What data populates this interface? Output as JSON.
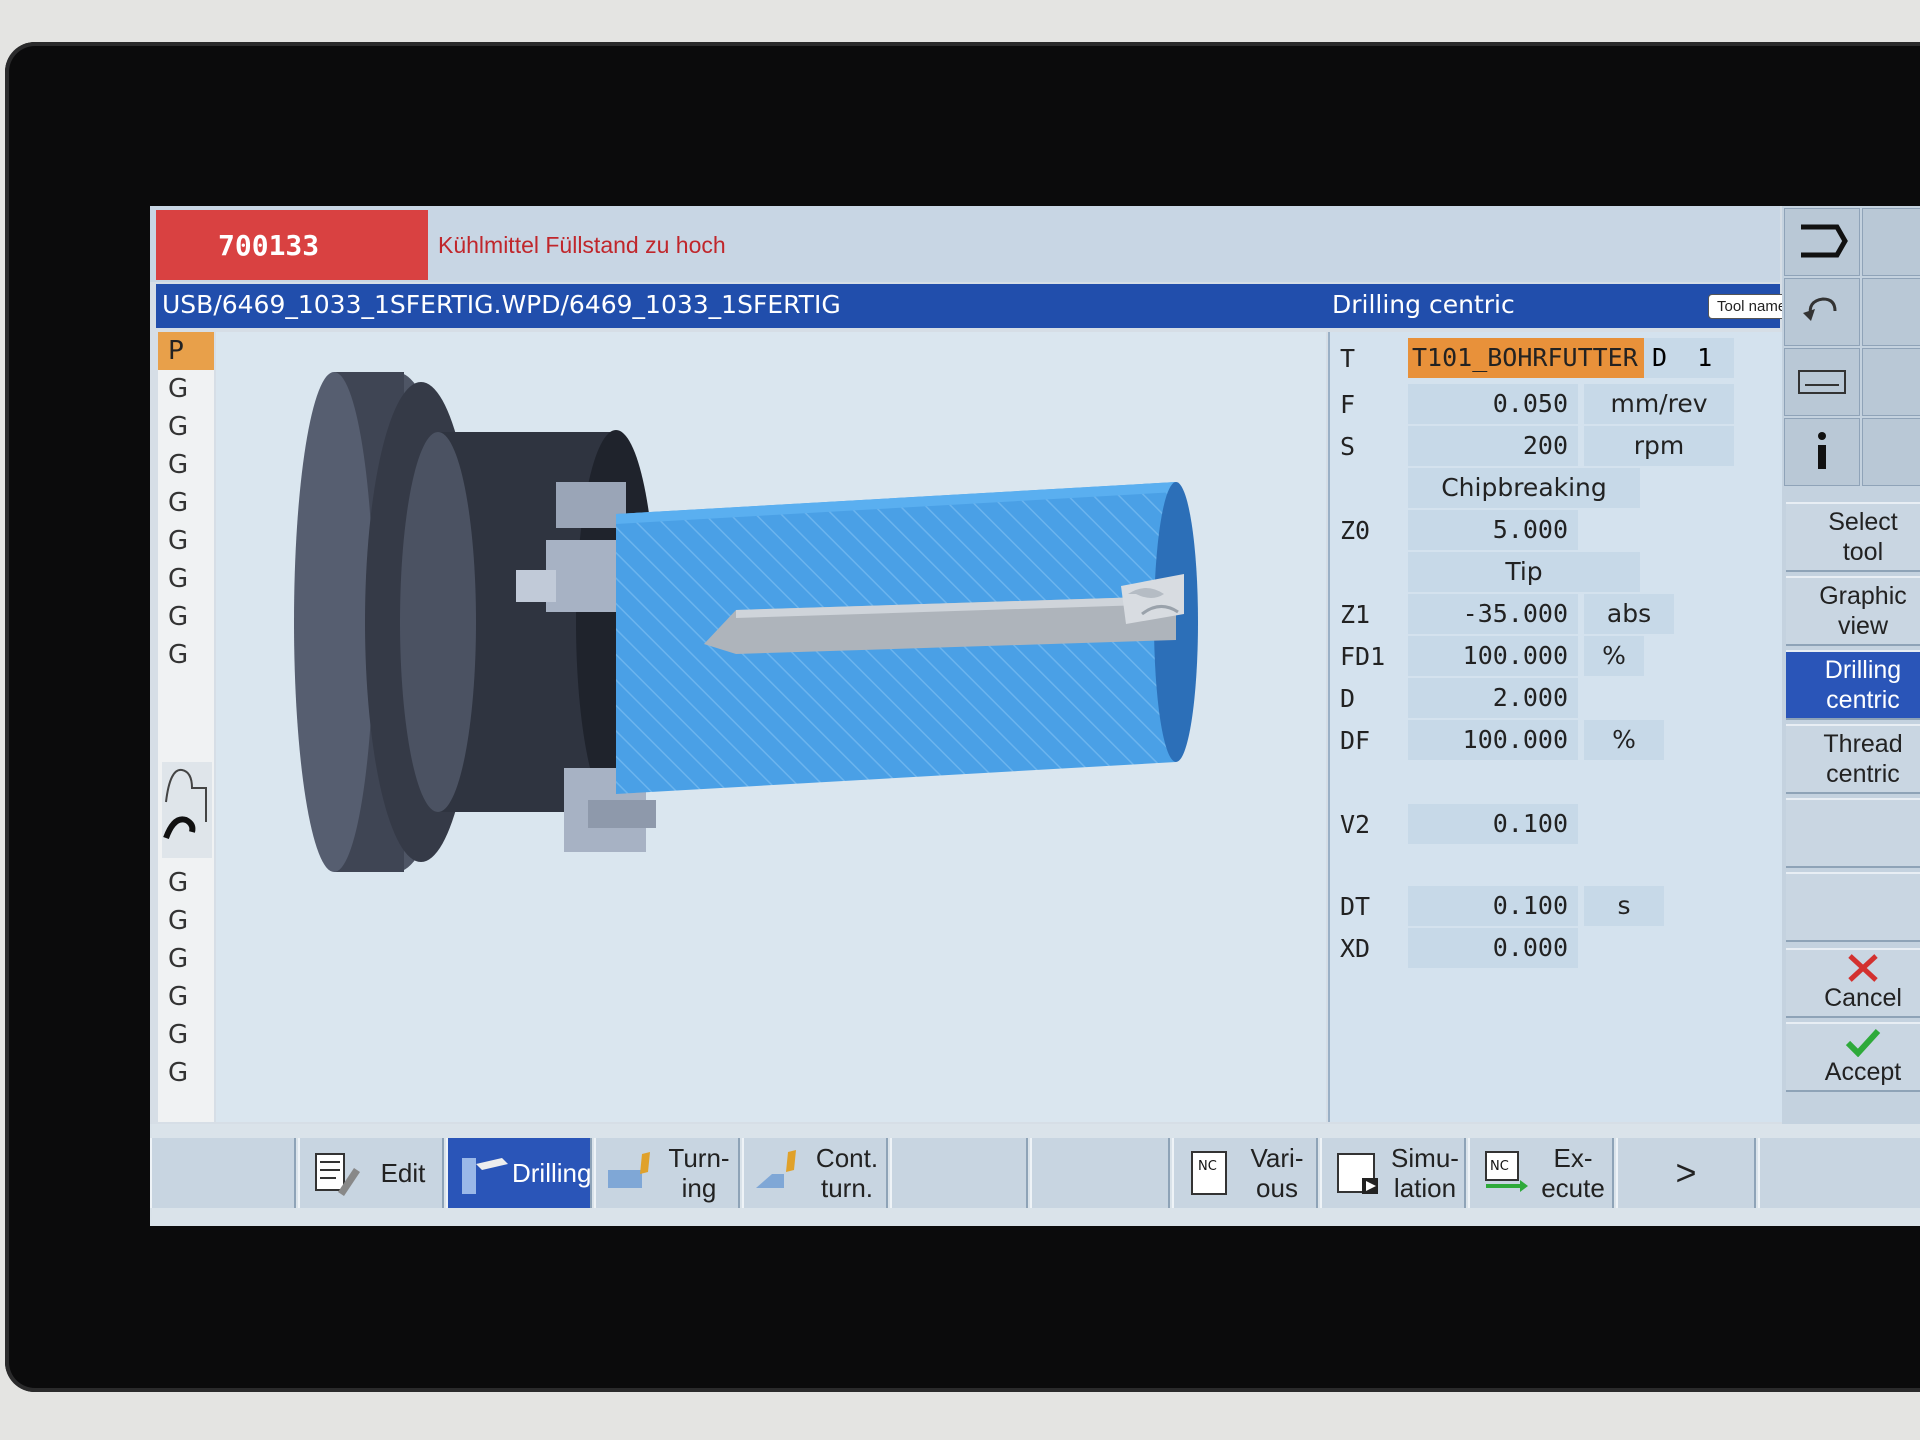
{
  "alarm": {
    "number": "700133",
    "message": "Kühlmittel Füllstand zu hoch"
  },
  "header": {
    "path": "USB/6469_1033_1SFERTIG.WPD/6469_1033_1SFERTIG",
    "cycle_title": "Drilling centric",
    "tooltip": "Tool name"
  },
  "gcol": {
    "items": [
      "P",
      "G",
      "G",
      "G",
      "G",
      "G",
      "G",
      "G",
      "G",
      "G",
      "G",
      "G",
      "G",
      "G",
      "G"
    ]
  },
  "params": {
    "tool": {
      "label": "T",
      "value": "T101_BOHRFUTTER",
      "d_label": "D",
      "d_value": "1"
    },
    "feed": {
      "label": "F",
      "value": "0.050",
      "unit": "mm/rev"
    },
    "speed": {
      "label": "S",
      "value": "200",
      "unit": "rpm"
    },
    "mode": "Chipbreaking",
    "z0": {
      "label": "Z0",
      "value": "5.000"
    },
    "ref": "Tip",
    "z1": {
      "label": "Z1",
      "value": "-35.000",
      "unit": "abs"
    },
    "fd1": {
      "label": "FD1",
      "value": "100.000",
      "unit": "%"
    },
    "d": {
      "label": "D",
      "value": "2.000"
    },
    "df": {
      "label": "DF",
      "value": "100.000",
      "unit": "%"
    },
    "v2": {
      "label": "V2",
      "value": "0.100"
    },
    "dt": {
      "label": "DT",
      "value": "0.100",
      "unit": "s"
    },
    "xd": {
      "label": "XD",
      "value": "0.000"
    }
  },
  "vsoftkeys": {
    "select_tool": "Select\ntool",
    "graphic_view": "Graphic\nview",
    "drilling_centric": "Drilling\ncentric",
    "thread_centric": "Thread\ncentric",
    "cancel": "Cancel",
    "accept": "Accept"
  },
  "hsoftkeys": {
    "edit": "Edit",
    "drilling": "Drilling",
    "turning": "Turn-\ning",
    "cont_turn": "Cont.\nturn.",
    "various": "Vari-\nous",
    "simulation": "Simu-\nlation",
    "execute": "Ex-\necute",
    "more": ">",
    "nc": "NC"
  },
  "colors": {
    "alarm_red": "#d94141",
    "header_blue": "#214eac",
    "active_blue": "#2a55b8",
    "tool_orange": "#e8913a",
    "part_blue": "#4aa0e6"
  },
  "icons": [
    "back-arrow-icon",
    "undo-icon",
    "keyboard-icon",
    "info-icon",
    "cancel-x-icon",
    "accept-check-icon",
    "edit-icon",
    "drilling-icon",
    "turning-icon",
    "contour-turning-icon",
    "nc-various-icon",
    "simulation-icon",
    "nc-execute-icon"
  ]
}
